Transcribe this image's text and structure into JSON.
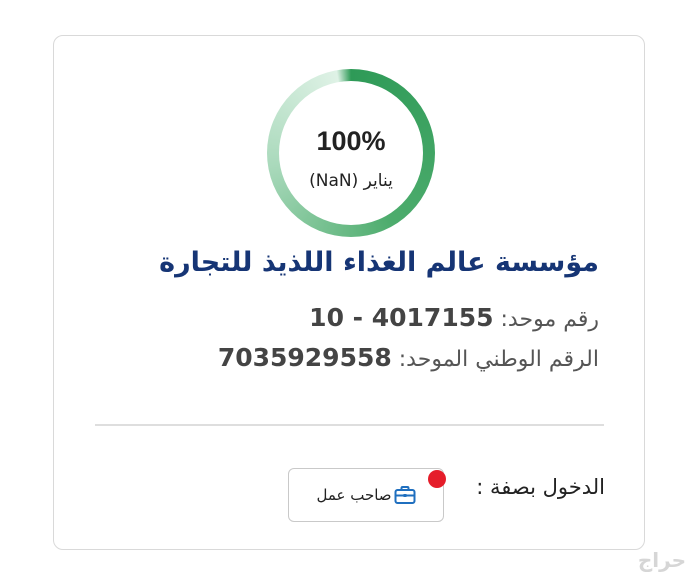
{
  "progress": {
    "percent_label": "100%",
    "percent_value": 100,
    "month_label": "يناير (NaN)"
  },
  "company": {
    "name": "مؤسسة عالم الغذاء اللذيذ للتجارة",
    "unified_number_label": "رقم موحد:",
    "unified_number_value": "10 - 4017155",
    "national_number_label": "الرقم الوطني الموحد:",
    "national_number_value": "7035929558"
  },
  "login": {
    "label": "الدخول بصفة :",
    "role_button": "صاحب عمل",
    "role_icon": "briefcase-icon"
  },
  "colors": {
    "ring": "#2e9a57",
    "title": "#163575",
    "badge": "#e51d2a"
  },
  "watermark": "حراج"
}
